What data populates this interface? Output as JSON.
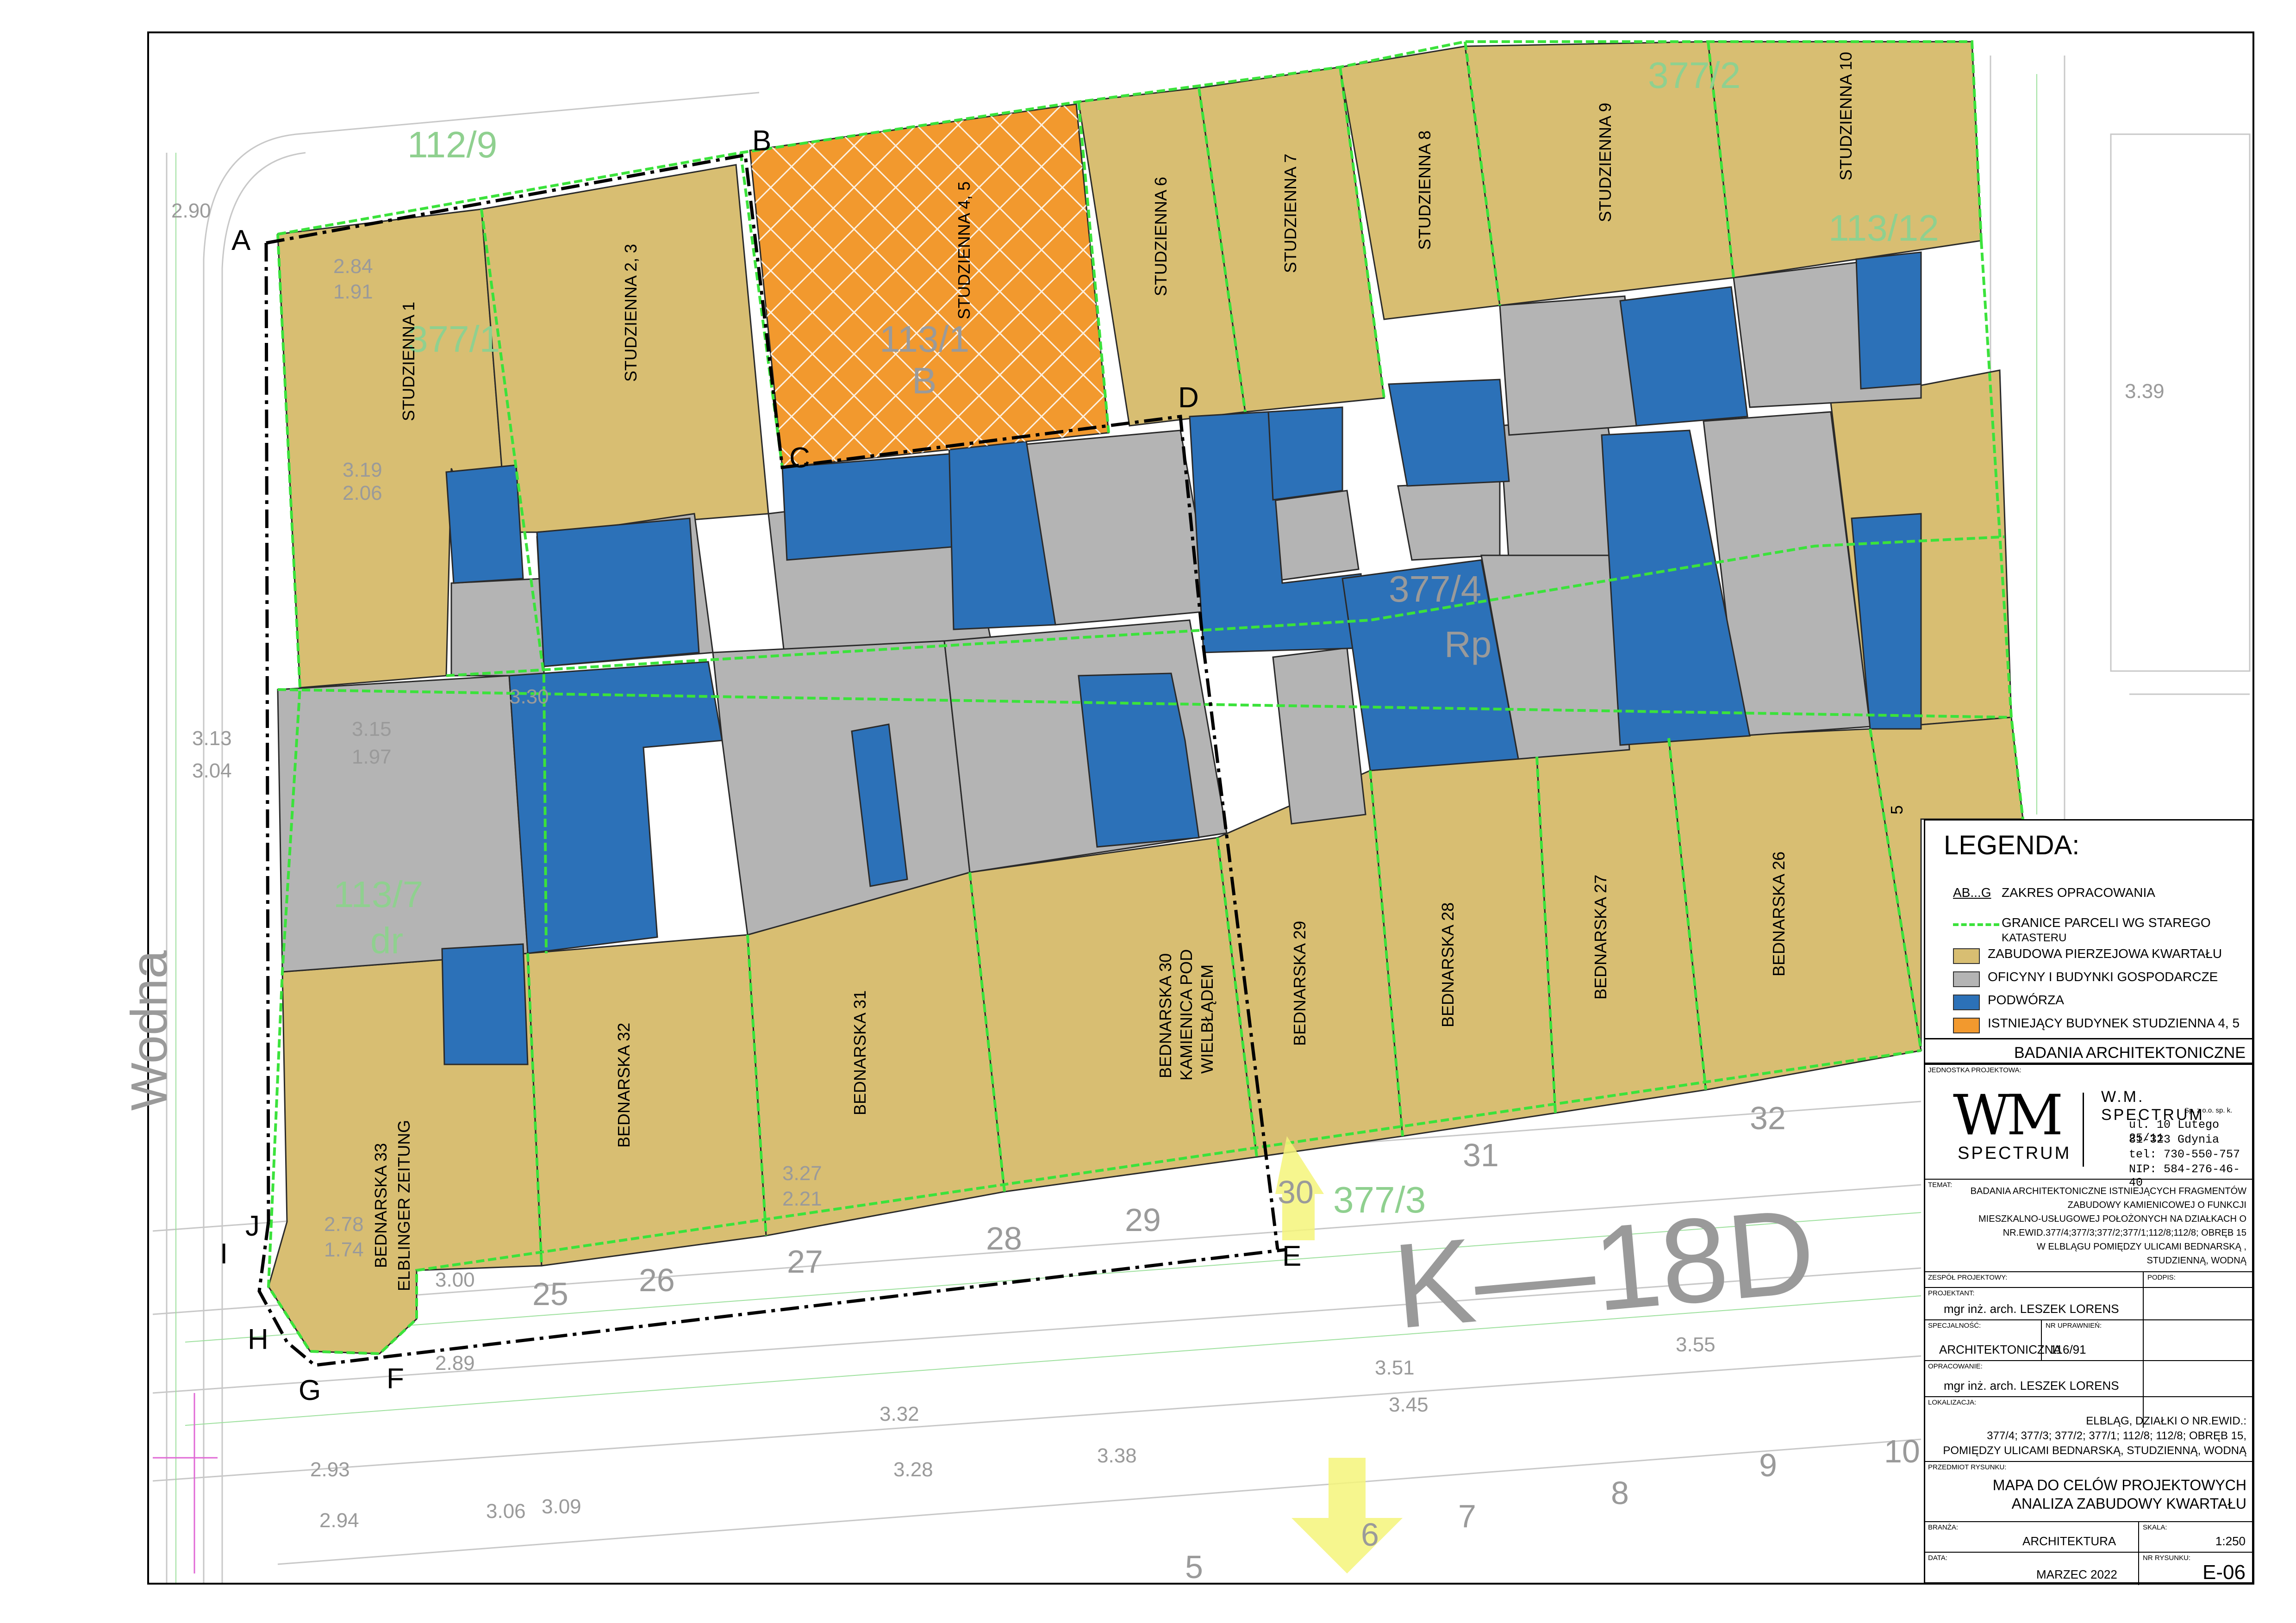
{
  "colors": {
    "frontage": "#d8be72",
    "outbuildings": "#b4b4b4",
    "courtyards": "#2c71b8",
    "existing_building": "#f2992e",
    "parcel_border": "#3be23b",
    "arrow": "#f5f57a"
  },
  "map": {
    "point_labels": {
      "a": "A",
      "b": "B",
      "c": "C",
      "d": "D",
      "e": "E",
      "f": "F",
      "g": "G",
      "h": "H",
      "i": "I",
      "j": "J"
    },
    "parcels": {
      "studzienna_1": "STUDZIENNA 1",
      "studzienna_2_3": "STUDZIENNA 2, 3",
      "studzienna_4_5": "STUDZIENNA 4, 5",
      "studzienna_6": "STUDZIENNA 6",
      "studzienna_7": "STUDZIENNA 7",
      "studzienna_8": "STUDZIENNA 8",
      "studzienna_9": "STUDZIENNA 9",
      "studzienna_10": "STUDZIENNA 10",
      "bednarska_33_line1": "BEDNARSKA 33",
      "bednarska_33_line2": "ELBLINGER ZEITUNG",
      "bednarska_32": "BEDNARSKA 32",
      "bednarska_31": "BEDNARSKA 31",
      "bednarska_30_line1": "BEDNARSKA 30",
      "bednarska_30_line2": "KAMIENICA POD",
      "bednarska_30_line3": "WIELBŁĄDEM",
      "bednarska_29": "BEDNARSKA 29",
      "bednarska_28": "BEDNARSKA 28",
      "bednarska_27": "BEDNARSKA 27",
      "bednarska_26": "BEDNARSKA 26",
      "bednarska_25": "5"
    },
    "background_text": {
      "street_wodna": "Wodna",
      "k18d": "K—18D",
      "p_113_1": "113/1",
      "p_113_1_b": "B",
      "p_377_4": "377/4",
      "p_377_4_rp": "Rp",
      "p_113_7": "113/7",
      "p_113_7_dr": "dr",
      "p_112_9": "112/9",
      "p_377_1": "377/1",
      "p_377_2": "377/2",
      "p_113_12": "113/12",
      "p_377_3": "377/3",
      "h_315": "3.15",
      "h_197": "1.97",
      "h_319": "3.19",
      "h_206": "2.06",
      "h_284": "2.84",
      "h_191": "1.91",
      "h_330": "3.30",
      "h_327": "3.27",
      "h_221": "2.21",
      "h_278": "2.78",
      "h_174": "1.74",
      "h_313": "3.13",
      "h_304": "3.04",
      "h_339": "3.39",
      "h_345": "3.45",
      "h_332": "3.32",
      "h_355": "3.55",
      "h_351": "3.51",
      "h_338": "3.38",
      "h_328": "3.28",
      "h_306": "3.06",
      "h_309": "3.09",
      "h_293": "2.93",
      "h_294": "2.94",
      "h_290": "2.90",
      "h_300": "3.00",
      "h_289": "2.89",
      "n_25": "25",
      "n_26": "26",
      "n_27": "27",
      "n_28": "28",
      "n_29": "29",
      "n_30": "30",
      "n_31": "31",
      "n_32": "32",
      "n_10": "10",
      "n_9": "9",
      "n_8": "8",
      "n_7": "7",
      "n_6": "6",
      "n_5": "5"
    }
  },
  "legend": {
    "title": "LEGENDA:",
    "scope_symbol": "AB...G",
    "scope_label": "ZAKRES OPRACOWANIA",
    "parcel_border_label_1": "GRANICE PARCELI WG STAREGO",
    "parcel_border_label_2": "KATASTERU",
    "frontage_label": "ZABUDOWA PIERZEJOWA KWARTAŁU",
    "outbuildings_label": "OFICYNY I BUDYNKI GOSPODARCZE",
    "courtyards_label": "PODWÓRZA",
    "existing_label": "ISTNIEJĄCY BUDYNEK STUDZIENNA 4, 5"
  },
  "title_block": {
    "header": "BADANIA ARCHITEKTONICZNE",
    "unit_caption": "JEDNOSTKA PROJEKTOWA:",
    "logo_letters": "WM",
    "logo_text": "SPECTRUM",
    "company": "W.M. SPECTRUM",
    "company_suffix": "Sp. z o.o. sp. k.",
    "address_1": "ul. 10 Lutego 25/11",
    "address_2": "81-323 Gdynia",
    "phone": "tel: 730-550-757",
    "nip": "NIP: 584-276-46-40",
    "topic_caption": "TEMAT:",
    "topic_1": "BADANIA ARCHITEKTONICZNE ISTNIEJĄCYCH FRAGMENTÓW",
    "topic_2": "ZABUDOWY KAMIENICOWEJ O FUNKCJI",
    "topic_3": "MIESZKALNO-USŁUGOWEJ POŁOŻONYCH NA  DZIAŁKACH O",
    "topic_4": "NR.EWID.377/4;377/3;377/2;377/1;112/8;112/8; OBRĘB 15",
    "topic_5": "W ELBLĄGU POMIĘDZY ULICAMI  BEDNARSKĄ ,",
    "topic_6": "STUDZIENNĄ, WODNĄ",
    "team_caption": "ZESPÓŁ PROJEKTOWY:",
    "signature_caption": "PODPIS:",
    "designer_caption": "PROJEKTANT:",
    "designer": "mgr inż. arch. LESZEK LORENS",
    "specialty_caption": "SPECJALNOŚĆ:",
    "license_caption": "NR UPRAWNIEŃ:",
    "specialty": "ARCHITEKTONICZNA",
    "license": "116/91",
    "prepared_caption": "OPRACOWANIE:",
    "prepared": "mgr inż. arch. LESZEK LORENS",
    "location_caption": "LOKALIZACJA:",
    "location_1": "ELBLĄG, DZIAŁKI O NR.EWID.:",
    "location_2": "377/4; 377/3; 377/2; 377/1; 112/8; 112/8; OBRĘB 15,",
    "location_3": "POMIĘDZY ULICAMI  BEDNARSKĄ, STUDZIENNĄ, WODNĄ",
    "subject_caption": "PRZEDMIOT RYSUNKU:",
    "subject_1": "MAPA DO CELÓW PROJEKTOWYCH",
    "subject_2": "ANALIZA ZABUDOWY KWARTAŁU",
    "branch_caption": "BRANŻA:",
    "scale_caption": "SKALA:",
    "branch": "ARCHITEKTURA",
    "scale": "1:250",
    "date_caption": "DATA:",
    "drawing_no_caption": "NR RYSUNKU:",
    "date": "MARZEC 2022",
    "drawing_no": "E-06"
  }
}
